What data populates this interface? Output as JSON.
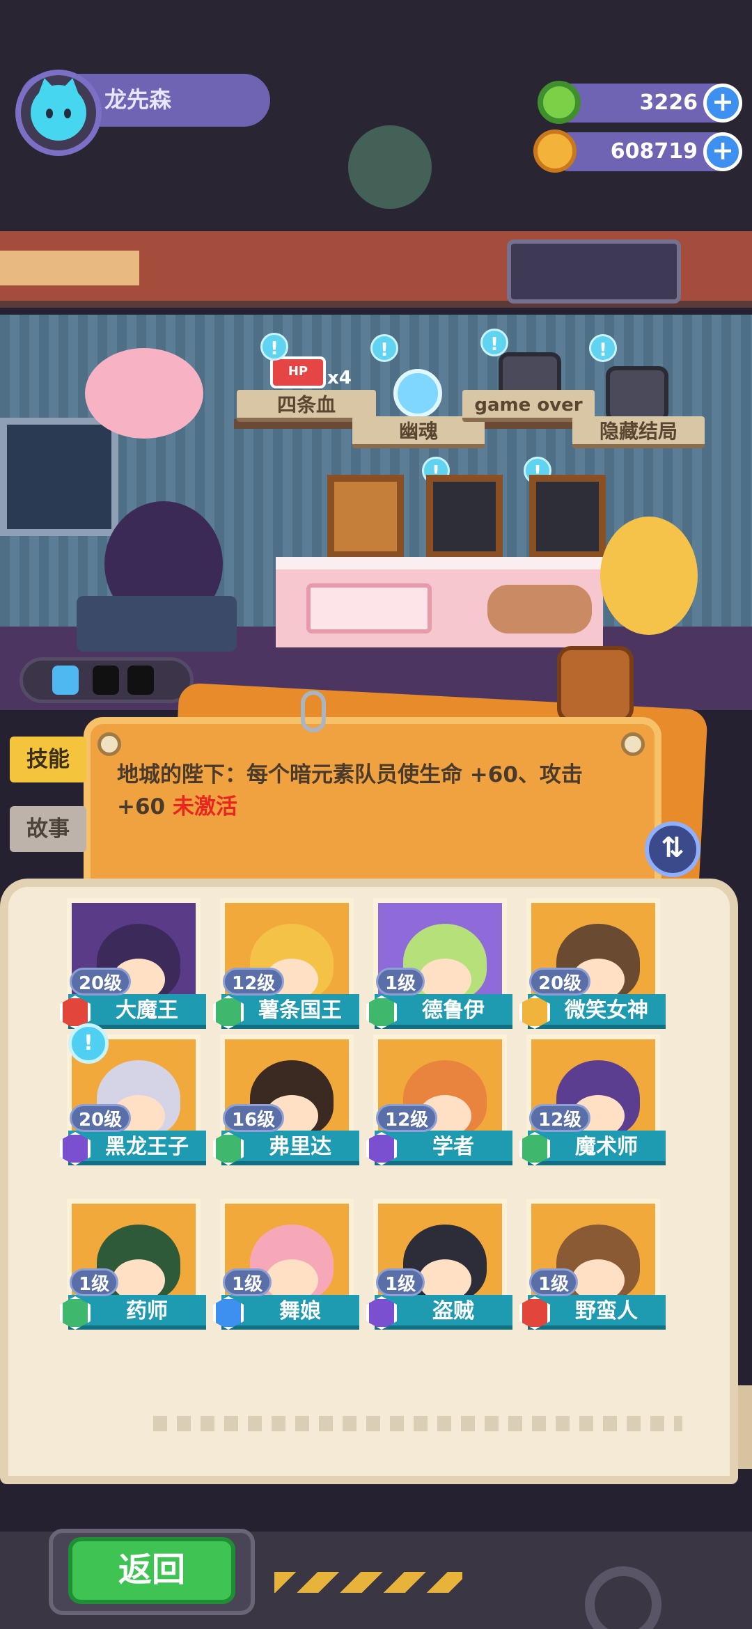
{
  "player": {
    "name": "龙先森"
  },
  "resources": [
    {
      "icon": "donut-coin-icon",
      "value": "3226",
      "color": "#7ad046"
    },
    {
      "icon": "planet-coin-icon",
      "value": "608719",
      "color": "#f3b23a"
    }
  ],
  "room": {
    "signs": [
      {
        "label": "四条血",
        "icon": "hp-icon",
        "icon_text": "HP",
        "count": "x4"
      },
      {
        "label": "幽魂",
        "icon": "skull-icon"
      },
      {
        "label": "game over",
        "icon": "tombstone-tv-icon"
      },
      {
        "label": "隐藏结局",
        "icon": "picture-tv-icon"
      }
    ],
    "alert": "!"
  },
  "tabs": {
    "skill": "技能",
    "story": "故事"
  },
  "skill_board": {
    "text": "地城的陛下：每个暗元素队员使生命 +60、攻击 +60",
    "status": " 未激活"
  },
  "heroes": [
    {
      "name": "大魔王",
      "level": "20级",
      "class_color": "#e2463a",
      "art_color": "#5a3b87",
      "hair": "#3b2a5a"
    },
    {
      "name": "薯条国王",
      "level": "12级",
      "class_color": "#3fb86e",
      "art_color": "#f2a93b",
      "hair": "#f3c246"
    },
    {
      "name": "德鲁伊",
      "level": "1级",
      "class_color": "#3fb86e",
      "art_color": "#8f6bd9",
      "hair": "#b6e07a"
    },
    {
      "name": "微笑女神",
      "level": "20级",
      "class_color": "#f0b33c",
      "art_color": "#f2a93b",
      "hair": "#6b4a32"
    },
    {
      "name": "黑龙王子",
      "level": "20级",
      "class_color": "#7a4fd0",
      "art_color": "#f2a93b",
      "hair": "#d4d4e6"
    },
    {
      "name": "弗里达",
      "level": "16级",
      "class_color": "#3fb86e",
      "art_color": "#f2a93b",
      "hair": "#3b2a22"
    },
    {
      "name": "学者",
      "level": "12级",
      "class_color": "#7a4fd0",
      "art_color": "#f2a93b",
      "hair": "#e8843d"
    },
    {
      "name": "魔术师",
      "level": "12级",
      "class_color": "#3fb86e",
      "art_color": "#f2a93b",
      "hair": "#5b3e8f"
    },
    {
      "name": "药师",
      "level": "1级",
      "class_color": "#3fb86e",
      "art_color": "#f2a93b",
      "hair": "#2f5a3a"
    },
    {
      "name": "舞娘",
      "level": "1级",
      "class_color": "#3d8ff0",
      "art_color": "#f2a93b",
      "hair": "#f7a8b8"
    },
    {
      "name": "盗贼",
      "level": "1级",
      "class_color": "#7a4fd0",
      "art_color": "#f2a93b",
      "hair": "#2d2d3a"
    },
    {
      "name": "野蛮人",
      "level": "1级",
      "class_color": "#e2463a",
      "art_color": "#f2a93b",
      "hair": "#8a5a34"
    }
  ],
  "bottom": {
    "back_label": "返回"
  },
  "plus_label": "+",
  "swap_label": "⇅"
}
